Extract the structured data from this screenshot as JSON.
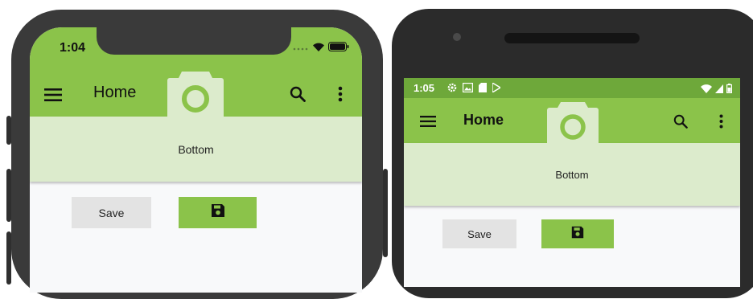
{
  "colors": {
    "accent": "#8bc34a",
    "band": "#dcebcc",
    "android_status": "#6ea83a",
    "save_bg": "#e3e3e3"
  },
  "iphone": {
    "status": {
      "time": "1:04",
      "icons": [
        "signal-dots-icon",
        "wifi-icon",
        "battery-icon"
      ]
    },
    "toolbar": {
      "menu_icon": "menu-icon",
      "title": "Home",
      "center_icon": "camera-icon",
      "search_icon": "search-icon",
      "more_icon": "more-vert-icon"
    },
    "bottom": {
      "label": "Bottom"
    },
    "buttons": {
      "save_label": "Save",
      "disk_icon": "save-disk-icon"
    }
  },
  "android": {
    "status": {
      "time": "1:05",
      "icons": [
        "settings-icon",
        "image-icon",
        "sd-card-icon",
        "play-store-icon"
      ],
      "right_icons": [
        "wifi-icon",
        "signal-icon",
        "battery-icon"
      ]
    },
    "toolbar": {
      "menu_icon": "menu-icon",
      "title": "Home",
      "center_icon": "camera-icon",
      "search_icon": "search-icon",
      "more_icon": "more-vert-icon"
    },
    "bottom": {
      "label": "Bottom"
    },
    "buttons": {
      "save_label": "Save",
      "disk_icon": "save-disk-icon"
    }
  }
}
